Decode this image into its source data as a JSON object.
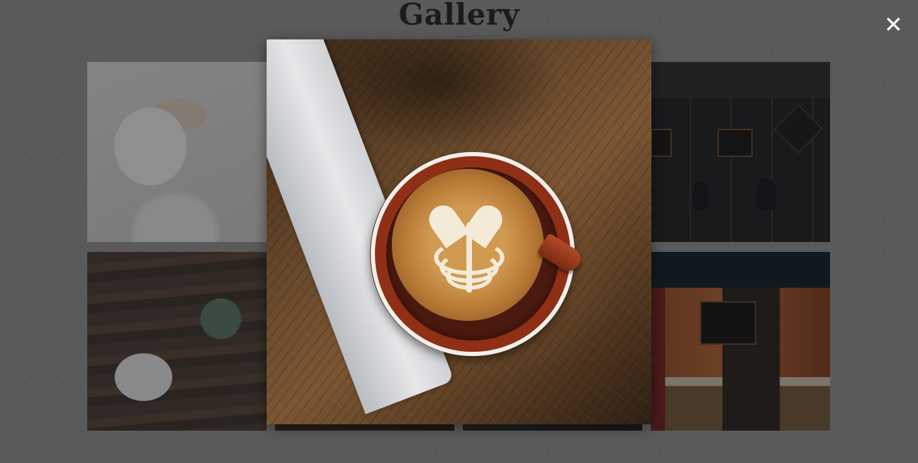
{
  "page": {
    "title": "Gallery"
  },
  "gallery": {
    "thumbnails": [
      {
        "alt": "whipped-cream-cup"
      },
      {
        "alt": "photo-2"
      },
      {
        "alt": "photo-3"
      },
      {
        "alt": "coffee-shop-counter"
      },
      {
        "alt": "latte-with-succulent"
      },
      {
        "alt": "photo-6"
      },
      {
        "alt": "photo-7"
      },
      {
        "alt": "cafe-interior"
      }
    ]
  },
  "lightbox": {
    "image": "latte-art-on-wooden-table",
    "close_icon": "close-icon",
    "close_glyph": "✕",
    "overlay_color": "#141416"
  }
}
